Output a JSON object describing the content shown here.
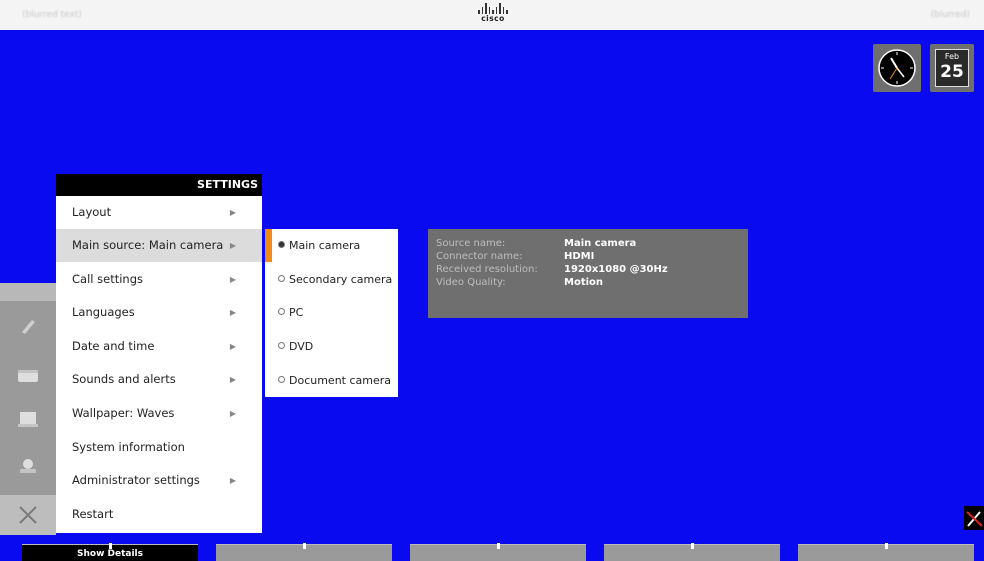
{
  "topbar": {
    "left_text": "(blurred text)",
    "right_text": "(blurred)",
    "logo_word": "cisco"
  },
  "clock": {
    "icon": "analog-clock-icon"
  },
  "date": {
    "month": "Feb",
    "day": "25"
  },
  "settings": {
    "header": "SETTINGS",
    "items": [
      {
        "label": "Layout",
        "has_arrow": true,
        "arrow": "▶"
      },
      {
        "label": "Main source: Main camera",
        "has_arrow": true,
        "arrow": "▶"
      },
      {
        "label": "Call settings",
        "has_arrow": true,
        "arrow": "▶"
      },
      {
        "label": "Languages",
        "has_arrow": true,
        "arrow": "▶"
      },
      {
        "label": "Date and time",
        "has_arrow": true,
        "arrow": "▶"
      },
      {
        "label": "Sounds and alerts",
        "has_arrow": true,
        "arrow": "▶"
      },
      {
        "label": "Wallpaper: Waves",
        "has_arrow": true,
        "arrow": "▶"
      },
      {
        "label": "System information",
        "has_arrow": false
      },
      {
        "label": "Administrator settings",
        "has_arrow": true,
        "arrow": "▶"
      },
      {
        "label": "Restart",
        "has_arrow": false
      }
    ]
  },
  "source_options": [
    {
      "label": "Main camera",
      "selected": true
    },
    {
      "label": "Secondary camera",
      "selected": false
    },
    {
      "label": "PC",
      "selected": false
    },
    {
      "label": "DVD",
      "selected": false
    },
    {
      "label": "Document camera",
      "selected": false
    }
  ],
  "source_info": {
    "source_name_label": "Source name:",
    "source_name_value": "Main camera",
    "connector_label": "Connector name:",
    "connector_value": "HDMI",
    "resolution_label": "Received resolution:",
    "resolution_value": "1920x1080 @30Hz",
    "quality_label": "Video Quality:",
    "quality_value": "Motion"
  },
  "left_column": {
    "icons": [
      "phone-icon",
      "contacts-icon",
      "presentation-icon",
      "camera-icon",
      "tools-icon"
    ]
  },
  "bottom_bar": {
    "show_details_label": "Show Details"
  },
  "colors": {
    "background": "#0a0af0",
    "accent": "#f08a1c",
    "panel_gray": "#6f6f6f"
  }
}
